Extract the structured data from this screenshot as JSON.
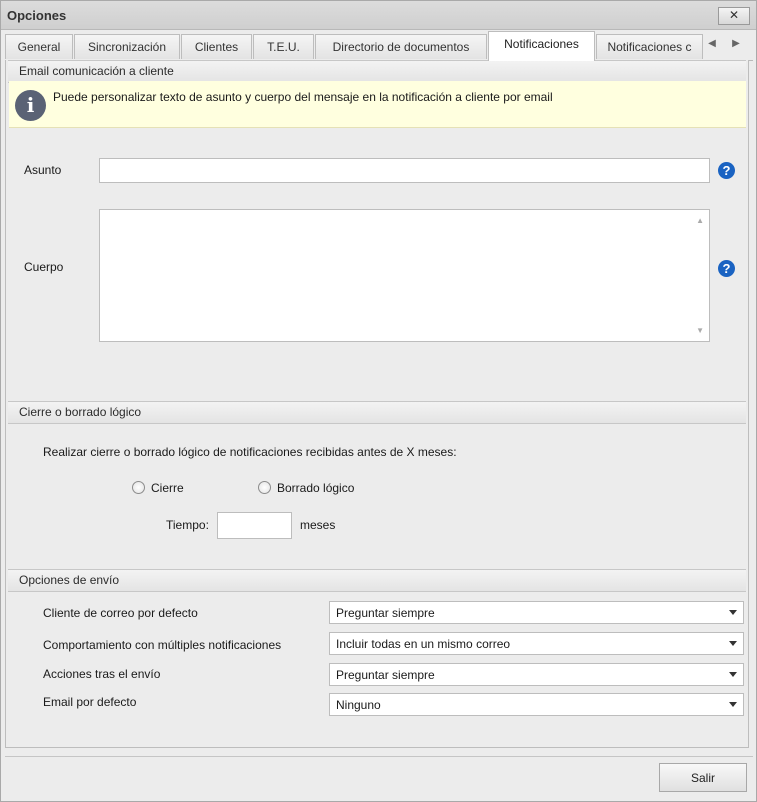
{
  "window": {
    "title": "Opciones",
    "close_glyph": "✕"
  },
  "tabs": [
    {
      "label": "General"
    },
    {
      "label": "Sincronización"
    },
    {
      "label": "Clientes"
    },
    {
      "label": "T.E.U."
    },
    {
      "label": "Directorio de documentos"
    },
    {
      "label": "Notificaciones",
      "active": true
    },
    {
      "label": "Notificaciones c"
    }
  ],
  "tab_scroll": {
    "left": "◀",
    "right": "▶"
  },
  "email_section": {
    "header": "Email comunicación a cliente",
    "info_icon": "i",
    "info_text": "Puede personalizar texto de asunto y cuerpo del mensaje en la notificación a cliente por email",
    "asunto_label": "Asunto",
    "asunto_value": "",
    "cuerpo_label": "Cuerpo",
    "cuerpo_value": "",
    "help_glyph": "?",
    "scroll_up": "▲",
    "scroll_down": "▼"
  },
  "cierre_section": {
    "header": "Cierre o borrado lógico",
    "description": "Realizar cierre o borrado lógico de notificaciones recibidas antes de X meses:",
    "radio_cierre": "Cierre",
    "radio_borrado": "Borrado lógico",
    "tiempo_label": "Tiempo:",
    "tiempo_value": "",
    "meses_label": "meses"
  },
  "envio_section": {
    "header": "Opciones de envío",
    "rows": [
      {
        "label": "Cliente de correo por defecto",
        "value": "Preguntar siempre"
      },
      {
        "label": "Comportamiento con múltiples notificaciones",
        "value": "Incluir todas en un mismo correo"
      },
      {
        "label": "Acciones tras el envío",
        "value": "Preguntar siempre"
      },
      {
        "label": "Email por defecto",
        "value": "Ninguno"
      }
    ]
  },
  "footer": {
    "salir_label": "Salir"
  }
}
